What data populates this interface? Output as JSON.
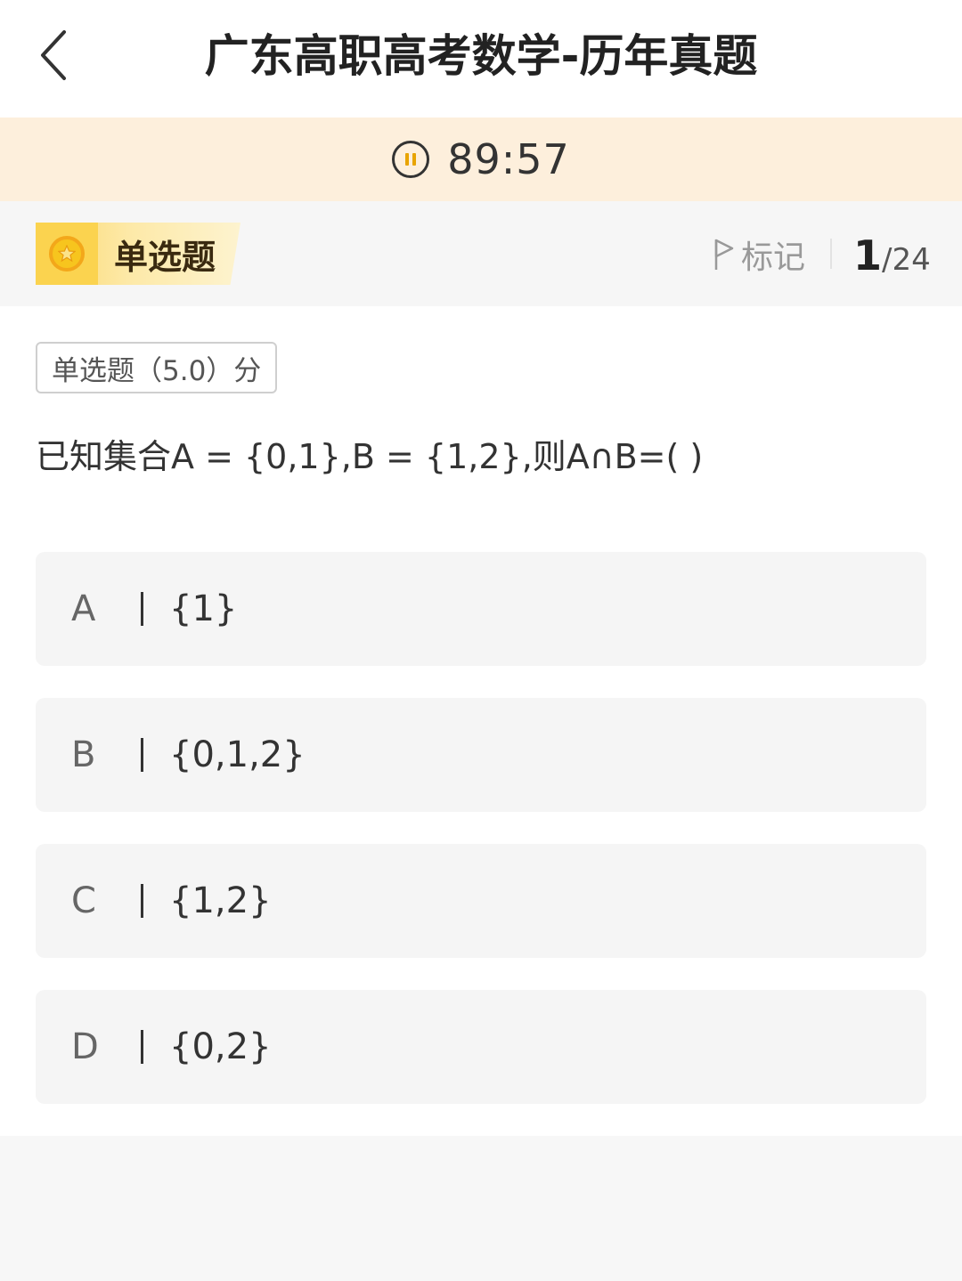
{
  "header": {
    "title": "广东高职高考数学-历年真题"
  },
  "timer": {
    "time": "89:57"
  },
  "question_bar": {
    "type_label": "单选题",
    "mark_label": "标记",
    "current_index": "1",
    "separator": "/",
    "total": "24"
  },
  "question": {
    "score_tag": "单选题（5.0）分",
    "text": "已知集合A = {0,1},B = {1,2},则A∩B=( )",
    "options": [
      {
        "letter": "A",
        "text": "{1}"
      },
      {
        "letter": "B",
        "text": "{0,1,2}"
      },
      {
        "letter": "C",
        "text": "{1,2}"
      },
      {
        "letter": "D",
        "text": "{0,2}"
      }
    ]
  }
}
